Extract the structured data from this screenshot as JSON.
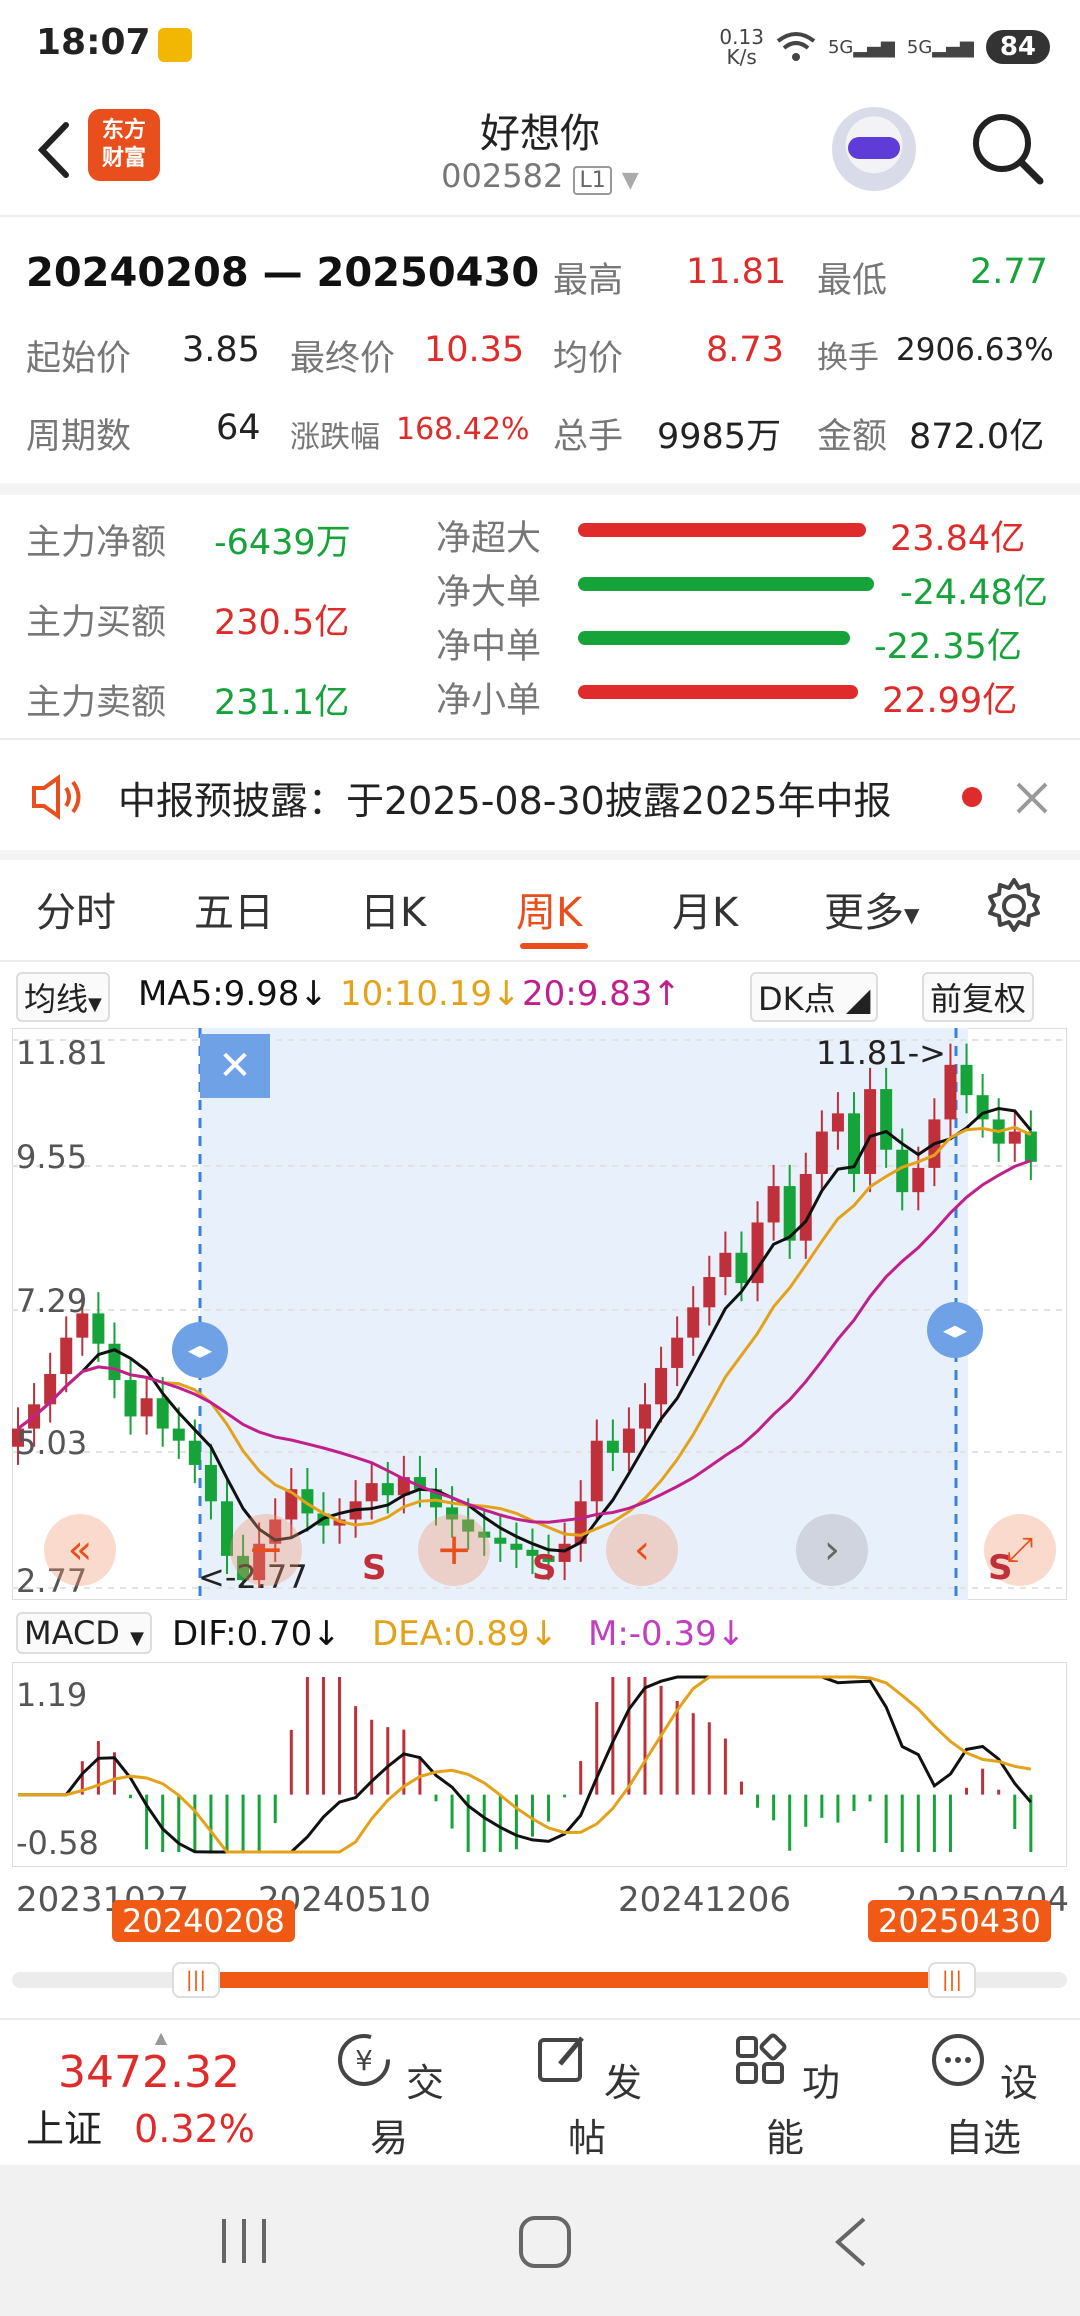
{
  "status_bar": {
    "time": "18:07",
    "net_speed_top": "0.13",
    "net_speed_bottom": "K/s",
    "net1": "5G",
    "net2": "5G",
    "battery": "84"
  },
  "header": {
    "stock_name": "好想你",
    "stock_code": "002582",
    "level": "L1",
    "logo_line1": "东方",
    "logo_line2": "财富"
  },
  "summary": {
    "date_range": "20240208 — 20250430",
    "high_label": "最高",
    "high": "11.81",
    "low_label": "最低",
    "low": "2.77",
    "open_label": "起始价",
    "open": "3.85",
    "close_label": "最终价",
    "close": "10.35",
    "avg_label": "均价",
    "avg": "8.73",
    "turnover_label": "换手",
    "turnover": "2906.63%",
    "periods_label": "周期数",
    "periods": "64",
    "change_label": "涨跌幅",
    "change": "168.42%",
    "volume_label": "总手",
    "volume": "9985万",
    "amount_label": "金额",
    "amount": "872.0亿"
  },
  "fund_flow": {
    "net_label": "主力净额",
    "net": "-6439万",
    "buy_label": "主力买额",
    "buy": "230.5亿",
    "sell_label": "主力卖额",
    "sell": "231.1亿",
    "items": [
      {
        "label": "净超大",
        "value": "23.84亿",
        "color": "#e02b2b"
      },
      {
        "label": "净大单",
        "value": "-24.48亿",
        "color": "#16a33a"
      },
      {
        "label": "净中单",
        "value": "-22.35亿",
        "color": "#16a33a"
      },
      {
        "label": "净小单",
        "value": "22.99亿",
        "color": "#e02b2b"
      }
    ]
  },
  "notice": {
    "text": "中报预披露：于2025-08-30披露2025年中报"
  },
  "tabs": [
    "分时",
    "五日",
    "日K",
    "周K",
    "月K",
    "更多"
  ],
  "active_tab": "周K",
  "chart_toolbar": {
    "ma_select": "均线",
    "ma5": "MA5:9.98",
    "ma10": "10:10.19",
    "ma20": "20:9.83",
    "dk": "DK点",
    "adjust": "前复权"
  },
  "kchart": {
    "y_labels": [
      "11.81",
      "9.55",
      "7.29",
      "5.03",
      "2.77"
    ],
    "high_marker": "11.81->",
    "low_marker": "<-2.77",
    "s_marks": [
      "S",
      "S",
      "S"
    ]
  },
  "macd": {
    "select": "MACD",
    "dif": "DIF:0.70",
    "dea": "DEA:0.89",
    "m": "M:-0.39",
    "y_labels": [
      "1.19",
      "-0.58"
    ]
  },
  "x_dates": [
    "20231027",
    "20240510",
    "20241206",
    "20250704"
  ],
  "range_badges": {
    "start": "20240208",
    "end": "20250430"
  },
  "bottom": {
    "index_value": "3472.32",
    "index_name": "上证",
    "index_change": "0.32%",
    "nav": [
      "交易",
      "发帖",
      "功能",
      "设自选"
    ]
  },
  "colors": {
    "accent": "#e94f1c",
    "up": "#e02b2b",
    "down": "#16a33a",
    "ma5": "#111111",
    "ma10": "#e3a21a",
    "ma20": "#c0208c"
  },
  "chart_data": {
    "type": "candlestick",
    "title": "",
    "ylim": [
      2.77,
      11.81
    ],
    "candles_close": [
      5.4,
      5.8,
      6.3,
      6.9,
      7.3,
      6.8,
      6.2,
      5.6,
      5.9,
      5.4,
      5.2,
      4.8,
      4.2,
      3.3,
      2.9,
      3.5,
      3.9,
      4.4,
      4.0,
      3.8,
      3.9,
      4.2,
      4.5,
      4.3,
      4.6,
      4.4,
      4.1,
      3.9,
      3.7,
      3.6,
      3.5,
      3.4,
      3.3,
      3.2,
      3.5,
      4.2,
      5.2,
      5.0,
      5.4,
      5.8,
      6.4,
      6.9,
      7.4,
      7.9,
      8.3,
      7.8,
      8.8,
      9.4,
      8.5,
      9.6,
      10.3,
      10.6,
      9.6,
      11.0,
      10.0,
      9.3,
      9.7,
      10.5,
      11.4,
      10.9,
      10.5,
      10.1,
      10.3,
      9.8
    ],
    "ma5_range": [
      3.2,
      10.6
    ],
    "macd_ylim": [
      -0.58,
      1.19
    ]
  }
}
